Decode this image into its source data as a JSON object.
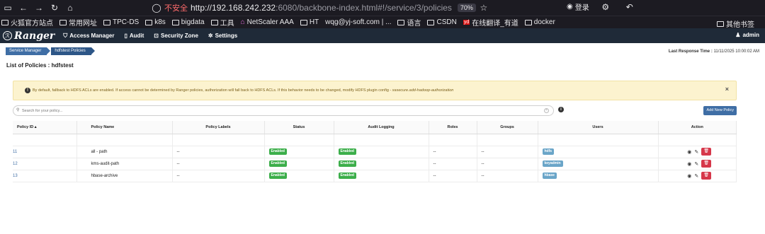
{
  "browser": {
    "insecure_label": "不安全",
    "url_host": "http://192.168.242.232",
    "url_path": ":6080/backbone-index.html#!/service/3/policies",
    "zoom": "70%",
    "account_label": "登录"
  },
  "bookmarks": {
    "items": [
      "火狐官方站点",
      "常用网址",
      "TPC-DS",
      "k8s",
      "bigdata",
      "工具",
      "NetScaler AAA",
      "HT",
      "wqg@yj-soft.com | ...",
      "语言",
      "CSDN",
      "在线翻译_有道",
      "docker"
    ],
    "other": "其他书签"
  },
  "nav": {
    "logo": "Ranger",
    "items": [
      {
        "label": "Access Manager",
        "icon": "shield-icon"
      },
      {
        "label": "Audit",
        "icon": "file-icon"
      },
      {
        "label": "Security Zone",
        "icon": "zone-icon"
      },
      {
        "label": "Settings",
        "icon": "gear-icon"
      }
    ],
    "user": "admin"
  },
  "breadcrumb": [
    "Service Manager",
    "hdfstest Policies"
  ],
  "last_response": {
    "label": "Last Response Time :",
    "value": "11/11/2025 10:00:02 AM"
  },
  "page_title": "List of Policies : hdfstest",
  "alert": {
    "text": "By default, fallback to HDFS ACLs are enabled. If access cannot be determined by Ranger policies, authorization will fall back to HDFS ACLs. If this behavior needs to be changed, modify HDFS plugin config - ",
    "config_key": "xasecure.add-hadoop-authorization",
    "close": "×"
  },
  "search": {
    "placeholder": "Search for your policy..."
  },
  "add_button": "Add New Policy",
  "table": {
    "headers": [
      "Policy ID ▴",
      "Policy Name",
      "Policy Labels",
      "Status",
      "Audit Logging",
      "Roles",
      "Groups",
      "Users",
      "Action"
    ],
    "rows": [
      {
        "id": "11",
        "name": "all - path",
        "labels": "--",
        "status": "Enabled",
        "audit": "Enabled",
        "roles": "--",
        "groups": "--",
        "users": "hdfs"
      },
      {
        "id": "12",
        "name": "kms-audit-path",
        "labels": "--",
        "status": "Enabled",
        "audit": "Enabled",
        "roles": "--",
        "groups": "--",
        "users": "keyadmin"
      },
      {
        "id": "13",
        "name": "hbase-archive",
        "labels": "--",
        "status": "Enabled",
        "audit": "Enabled",
        "roles": "--",
        "groups": "--",
        "users": "hbase"
      }
    ]
  },
  "colors": {
    "nav_bg": "#1f2a38",
    "primary": "#3f6ea5",
    "enabled": "#3cae4a",
    "user_badge": "#6aa5c8",
    "delete": "#d6374a",
    "alert_bg": "#fcf3cf"
  }
}
